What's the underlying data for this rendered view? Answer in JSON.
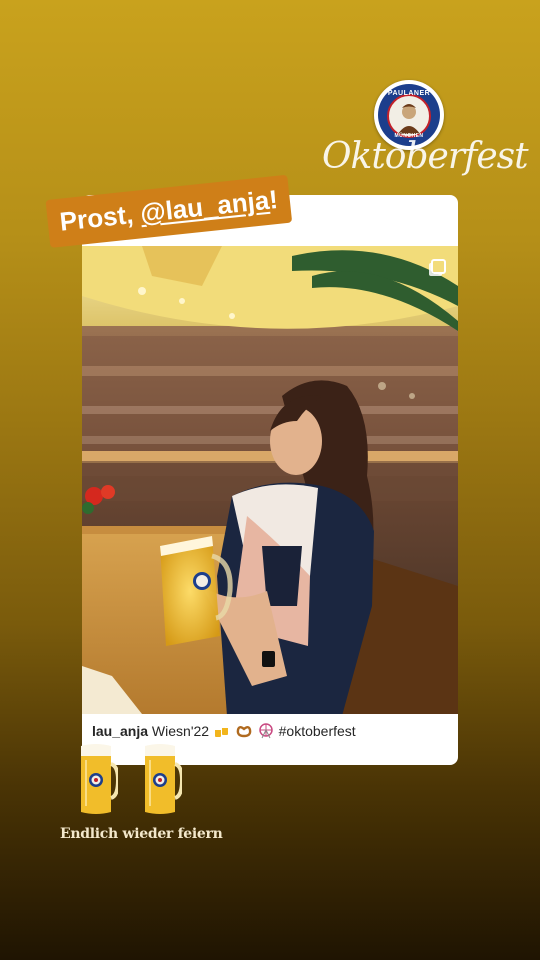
{
  "brand": {
    "seal_text_top": "PAULANER",
    "seal_text_bottom": "MÜNCHEN",
    "event_title": "Oktoberfest"
  },
  "mention_sticker": {
    "prefix": "Prost, ",
    "handle": "@lau_anja",
    "suffix": "!"
  },
  "post": {
    "username": "lau_anja",
    "caption_text": "Wiesn'22",
    "caption_emojis": [
      "beers-emoji",
      "pretzel-emoji",
      "ferris-wheel-emoji"
    ],
    "hashtag": "#oktoberfest"
  },
  "footer": {
    "text": "Endlich wieder feiern"
  },
  "colors": {
    "sticker": "#cf7f18",
    "brand_blue": "#1c3e8c",
    "brand_red": "#c2202a"
  }
}
